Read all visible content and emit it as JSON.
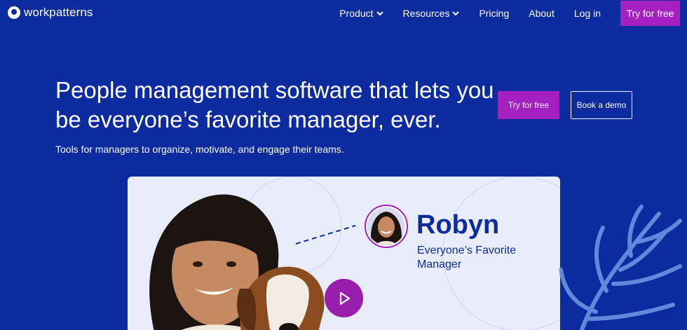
{
  "nav": {
    "brand": "workpatterns",
    "links": [
      {
        "label": "Product",
        "dropdown": true
      },
      {
        "label": "Resources",
        "dropdown": true
      },
      {
        "label": "Pricing",
        "dropdown": false
      },
      {
        "label": "About",
        "dropdown": false
      },
      {
        "label": "Log in",
        "dropdown": false
      }
    ],
    "cta": "Try for free"
  },
  "hero": {
    "title": "People management software that lets you be everyone’s favorite manager, ever.",
    "subtitle": "Tools for managers to organize, motivate, and engage their teams.",
    "primary_button": "Try for free",
    "secondary_button": "Book a demo"
  },
  "video": {
    "name": "Robyn",
    "role": "Everyone’s Favorite Manager"
  },
  "colors": {
    "background": "#0b2b9e",
    "accent": "#a51fc1",
    "card": "#e9ecfb"
  }
}
